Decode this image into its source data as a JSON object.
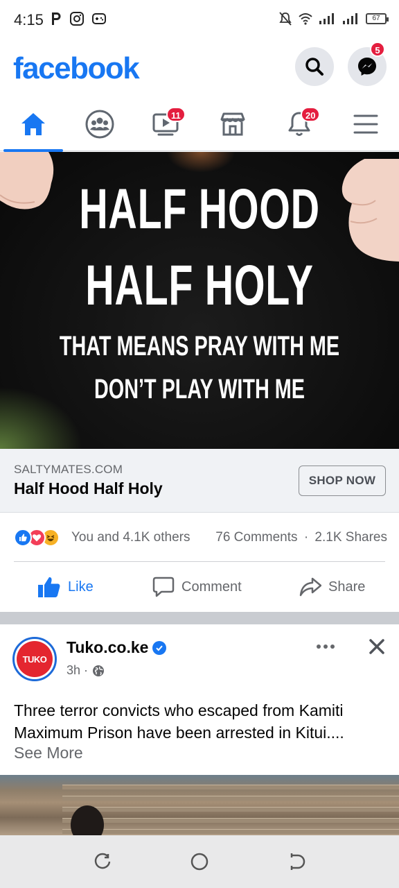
{
  "status_bar": {
    "time": "4:15",
    "battery": "67"
  },
  "header": {
    "brand": "facebook",
    "messenger_badge": "5"
  },
  "tabs": {
    "watch_badge": "11",
    "notifications_badge": "20"
  },
  "ad": {
    "image_lines": [
      "HALF HOOD",
      "HALF HOLY",
      "THAT MEANS PRAY WITH ME",
      "DON’T PLAY WITH ME"
    ],
    "domain": "SALTYMATES.COM",
    "title": "Half Hood Half Holy",
    "cta_label": "SHOP NOW",
    "reactions_text": "You and 4.1K others",
    "comments_text": "76 Comments",
    "shares_text": "2.1K Shares",
    "separator": "·"
  },
  "actions": {
    "like_label": "Like",
    "comment_label": "Comment",
    "share_label": "Share"
  },
  "post": {
    "avatar_text": "TUKO",
    "author": "Tuko.co.ke",
    "time": "3h ·",
    "text": "Three terror convicts who escaped from Kamiti Maximum Prison have been arrested in Kitui....",
    "see_more": "See More"
  },
  "colors": {
    "brand": "#1877f2",
    "badge": "#e41e3f",
    "tuko_red": "#e4262f"
  }
}
